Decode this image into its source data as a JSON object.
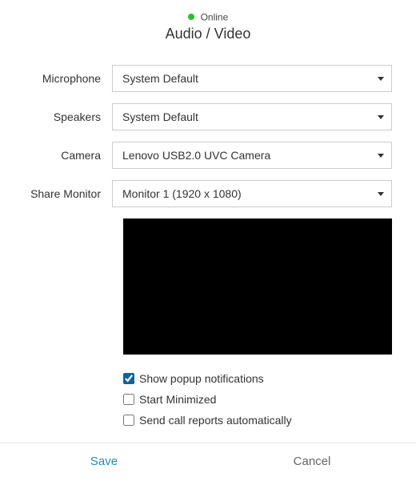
{
  "status": {
    "label": "Online",
    "dot_color": "#2dbd2d"
  },
  "title": "Audio / Video",
  "fields": {
    "microphone": {
      "label": "Microphone",
      "value": "System Default"
    },
    "speakers": {
      "label": "Speakers",
      "value": "System Default"
    },
    "camera": {
      "label": "Camera",
      "value": "Lenovo USB2.0 UVC Camera"
    },
    "monitor": {
      "label": "Share Monitor",
      "value": "Monitor 1 (1920 x 1080)"
    }
  },
  "checkboxes": {
    "popup": {
      "label": "Show popup notifications",
      "checked": true
    },
    "minimized": {
      "label": "Start Minimized",
      "checked": false
    },
    "reports": {
      "label": "Send call reports automatically",
      "checked": false
    }
  },
  "footer": {
    "save": "Save",
    "cancel": "Cancel"
  }
}
